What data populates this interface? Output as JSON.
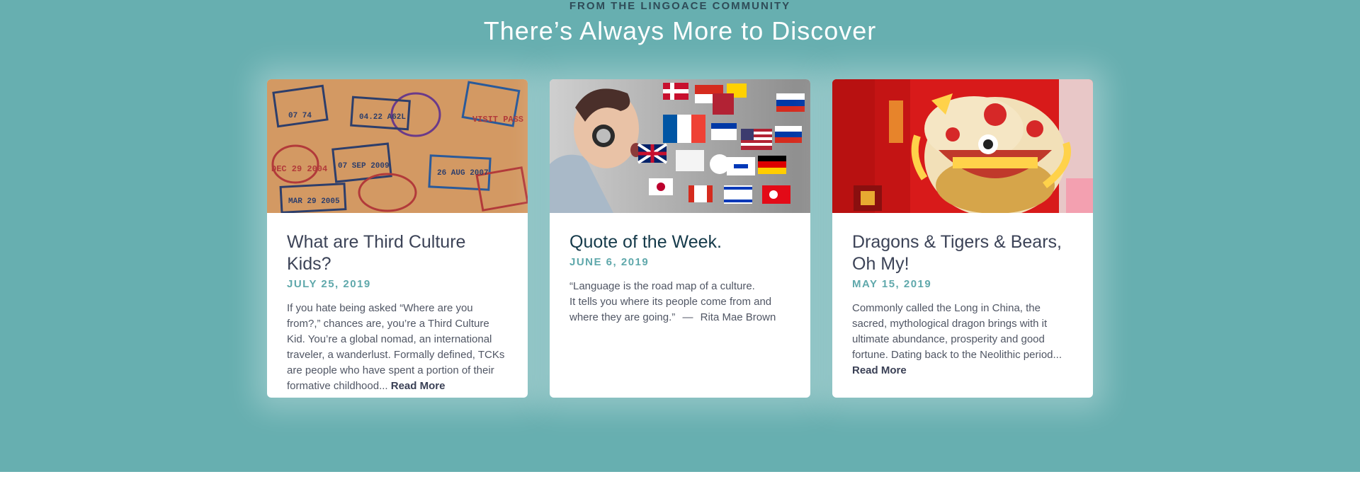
{
  "section": {
    "eyebrow": "FROM THE LINGOACE COMMUNITY",
    "headline": "There’s Always More to Discover"
  },
  "cards": [
    {
      "title": "What are Third Culture Kids?",
      "date": "JULY 25, 2019",
      "excerpt": "If you hate being asked “Where are you from?,” chances are, you’re a Third Culture Kid. You’re a global nomad, an international traveler, a wanderlust. Formally defined, TCKs are people who have spent a portion of their formative childhood...",
      "read_more": "Read More",
      "image_icon": "passport-stamps-image"
    },
    {
      "title": "Quote of the Week.",
      "date": "JUNE 6, 2019",
      "quote_line1": "“Language is the road map of a culture.",
      "quote_line2": "It tells you where its people come from and where they are going.”",
      "dash": "—",
      "author": "Rita Mae Brown",
      "image_icon": "boy-headphones-flags-image"
    },
    {
      "title": "Dragons & Tigers & Bears, Oh My!",
      "date": "MAY 15, 2019",
      "excerpt": "Commonly called the Long in China, the sacred, mythological dragon brings with it ultimate abundance, prosperity and good fortune. Dating back to the Neolithic period...",
      "read_more": "Read More",
      "image_icon": "lion-dance-image"
    }
  ],
  "colors": {
    "background": "#67afb0",
    "accent": "#5fa8ab",
    "title": "#3c4357"
  }
}
